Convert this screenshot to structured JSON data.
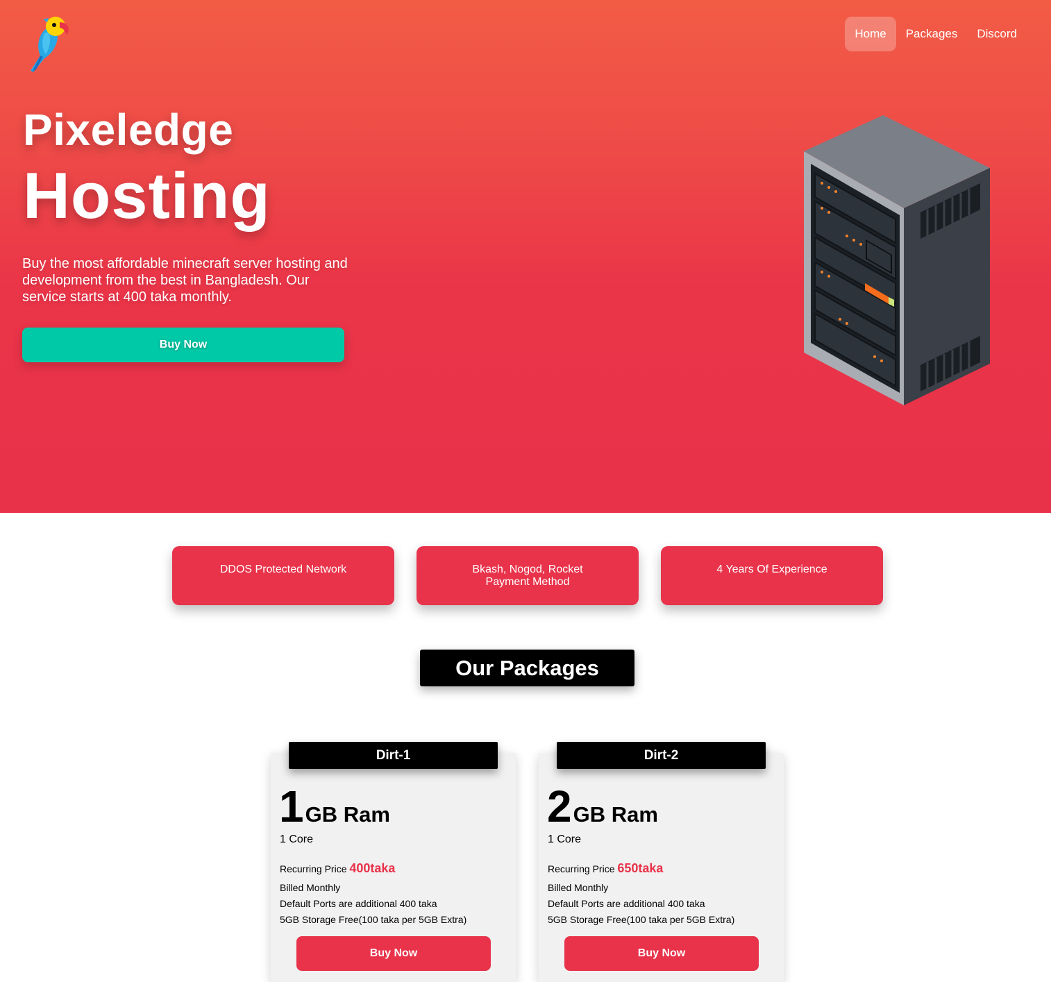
{
  "nav": {
    "items": [
      {
        "label": "Home",
        "active": true
      },
      {
        "label": "Packages",
        "active": false
      },
      {
        "label": "Discord",
        "active": false
      }
    ]
  },
  "hero": {
    "title_line1": "Pixeledge",
    "title_line2": "Hosting",
    "description": "Buy the most affordable minecraft server hosting and development from the best in Bangladesh. Our service starts at 400 taka monthly.",
    "buy_label": "Buy Now",
    "buy_color": "#00c9a7"
  },
  "features": [
    {
      "text": "DDOS Protected Network"
    },
    {
      "text": "Bkash, Nogod, Rocket Payment Method"
    },
    {
      "text": "4 Years Of Experience"
    }
  ],
  "packages_title": "Our Packages",
  "packages": [
    {
      "name": "Dirt-1",
      "ram_amount": "1",
      "ram_unit": "GB Ram",
      "cores": "1 Core",
      "price_label": "Recurring Price",
      "price": "400taka",
      "billing": "Billed Monthly",
      "ports": "Default Ports are additional 400 taka",
      "storage": "5GB Storage Free(100 taka per 5GB Extra)",
      "buy_label": "Buy Now"
    },
    {
      "name": "Dirt-2",
      "ram_amount": "2",
      "ram_unit": "GB Ram",
      "cores": "1 Core",
      "price_label": "Recurring Price",
      "price": "650taka",
      "billing": "Billed Monthly",
      "ports": "Default Ports are additional 400 taka",
      "storage": "5GB Storage Free(100 taka per 5GB Extra)",
      "buy_label": "Buy Now"
    }
  ],
  "colors": {
    "accent": "#e8334a",
    "hero_top": "#f25c45",
    "buy_teal": "#00c9a7"
  }
}
